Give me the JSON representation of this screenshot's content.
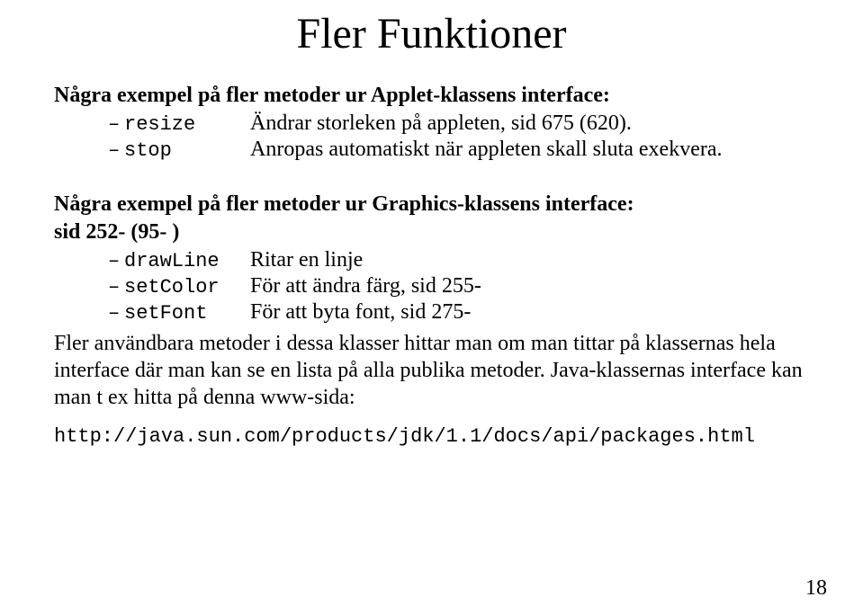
{
  "title": "Fler Funktioner",
  "section1": {
    "heading": "Några exempel på fler metoder ur Applet-klassens interface:",
    "items": [
      {
        "code": "resize",
        "desc": "Ändrar storleken på appleten, sid 675 (620)."
      },
      {
        "code": "stop",
        "desc": "Anropas automatiskt när appleten skall sluta exekvera."
      }
    ]
  },
  "section2": {
    "heading_line1": "Några exempel på fler metoder ur Graphics-klassens interface:",
    "heading_line2": "sid 252- (95- )",
    "items": [
      {
        "code": "drawLine",
        "desc": "Ritar en linje"
      },
      {
        "code": "setColor",
        "desc": "För att ändra färg, sid 255-"
      },
      {
        "code": "setFont",
        "desc": "För att byta font, sid 275-"
      }
    ]
  },
  "body_para1": "Fler användbara metoder i dessa klasser hittar man om man tittar på klassernas hela interface där man kan se en lista på alla publika metoder. Java-klassernas interface kan man t ex hitta på denna www-sida:",
  "url": "http://java.sun.com/products/jdk/1.1/docs/api/packages.html",
  "page_number": "18",
  "dash": "–"
}
